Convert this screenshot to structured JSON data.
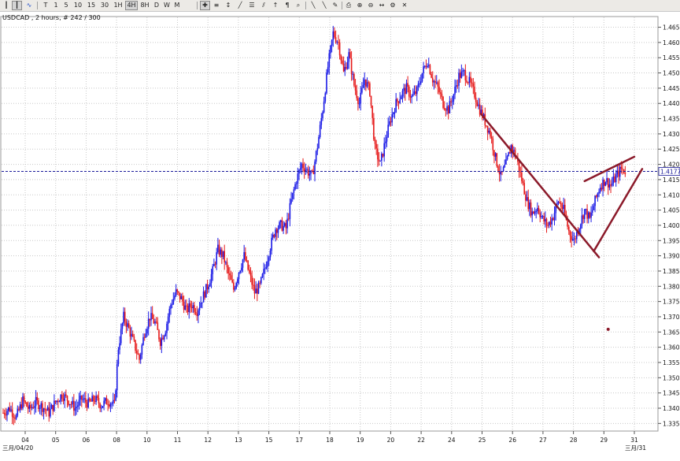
{
  "toolbar": {
    "timeframes": [
      "T",
      "1",
      "5",
      "10",
      "15",
      "30",
      "1H",
      "4H",
      "8H",
      "D",
      "W",
      "M"
    ],
    "active_timeframe": "2H"
  },
  "chart_data": {
    "type": "candlestick",
    "title": "USDCAD , 2 hours, # 242 / 300",
    "ylim": [
      1.3325,
      1.4685
    ],
    "y_ticks": [
      "1.4650",
      "1.4600",
      "1.4550",
      "1.4500",
      "1.4450",
      "1.4400",
      "1.4350",
      "1.4300",
      "1.4250",
      "1.4200",
      "1.4150",
      "1.4100",
      "1.4050",
      "1.4000",
      "1.3950",
      "1.3900",
      "1.3850",
      "1.3800",
      "1.3750",
      "1.3700",
      "1.3650",
      "1.3600",
      "1.3550",
      "1.3500",
      "1.3450",
      "1.3400",
      "1.3350"
    ],
    "x_ticks": [
      "04",
      "05",
      "06",
      "09",
      "10",
      "11",
      "12",
      "13",
      "16",
      "17",
      "18",
      "19",
      "20",
      "23",
      "24",
      "25",
      "26",
      "27",
      "30",
      "31",
      "02",
      "03",
      "06",
      "07",
      "08",
      "09",
      "10",
      "13",
      "14",
      "15",
      "16",
      "17",
      "20",
      "21",
      "22",
      "23",
      "24",
      "27",
      "28",
      "29",
      "30",
      "31"
    ],
    "x_tick_labels": [
      "04",
      "05",
      "06",
      "08",
      "10",
      "11",
      "12",
      "13",
      "15",
      "17",
      "18",
      "19",
      "20",
      "22",
      "24",
      "25",
      "26",
      "27",
      "28",
      "29",
      "31"
    ],
    "x_start_label": "三月/04/20",
    "x_end_label": "三月/31",
    "current_price": "1.4177",
    "current_price_value": 1.4177,
    "grid": true,
    "bull_color": "#1a1ae6",
    "bear_color": "#e61a1a",
    "annotation_color": "#8b1a2a",
    "path_points": [
      [
        0,
        1.3385
      ],
      [
        5,
        1.34
      ],
      [
        10,
        1.337
      ],
      [
        15,
        1.3425
      ],
      [
        20,
        1.3395
      ],
      [
        25,
        1.342
      ],
      [
        30,
        1.3405
      ],
      [
        35,
        1.3385
      ],
      [
        40,
        1.342
      ],
      [
        45,
        1.3445
      ],
      [
        50,
        1.3425
      ],
      [
        55,
        1.34
      ],
      [
        60,
        1.343
      ],
      [
        65,
        1.3415
      ],
      [
        70,
        1.343
      ],
      [
        75,
        1.341
      ],
      [
        80,
        1.3425
      ],
      [
        85,
        1.341
      ],
      [
        88,
        1.36
      ],
      [
        92,
        1.37
      ],
      [
        96,
        1.366
      ],
      [
        100,
        1.361
      ],
      [
        104,
        1.356
      ],
      [
        108,
        1.365
      ],
      [
        112,
        1.37
      ],
      [
        116,
        1.368
      ],
      [
        120,
        1.362
      ],
      [
        124,
        1.366
      ],
      [
        128,
        1.374
      ],
      [
        132,
        1.378
      ],
      [
        136,
        1.376
      ],
      [
        140,
        1.372
      ],
      [
        144,
        1.374
      ],
      [
        148,
        1.372
      ],
      [
        152,
        1.376
      ],
      [
        156,
        1.38
      ],
      [
        160,
        1.385
      ],
      [
        164,
        1.392
      ],
      [
        168,
        1.39
      ],
      [
        172,
        1.384
      ],
      [
        176,
        1.379
      ],
      [
        180,
        1.385
      ],
      [
        184,
        1.39
      ],
      [
        188,
        1.384
      ],
      [
        192,
        1.378
      ],
      [
        196,
        1.38
      ],
      [
        200,
        1.386
      ],
      [
        204,
        1.393
      ],
      [
        208,
        1.399
      ],
      [
        212,
        1.4
      ],
      [
        216,
        1.399
      ],
      [
        220,
        1.408
      ],
      [
        224,
        1.415
      ],
      [
        228,
        1.42
      ],
      [
        232,
        1.418
      ],
      [
        236,
        1.416
      ],
      [
        240,
        1.426
      ],
      [
        244,
        1.438
      ],
      [
        248,
        1.452
      ],
      [
        252,
        1.463
      ],
      [
        256,
        1.46
      ],
      [
        260,
        1.45
      ],
      [
        264,
        1.456
      ],
      [
        268,
        1.446
      ],
      [
        272,
        1.44
      ],
      [
        276,
        1.448
      ],
      [
        280,
        1.444
      ],
      [
        284,
        1.425
      ],
      [
        288,
        1.42
      ],
      [
        292,
        1.428
      ],
      [
        296,
        1.435
      ],
      [
        300,
        1.44
      ],
      [
        304,
        1.443
      ],
      [
        308,
        1.445
      ],
      [
        312,
        1.442
      ],
      [
        316,
        1.444
      ],
      [
        320,
        1.45
      ],
      [
        324,
        1.454
      ],
      [
        328,
        1.448
      ],
      [
        332,
        1.445
      ],
      [
        336,
        1.44
      ],
      [
        340,
        1.438
      ],
      [
        344,
        1.443
      ],
      [
        348,
        1.449
      ],
      [
        352,
        1.45
      ],
      [
        356,
        1.447
      ],
      [
        360,
        1.443
      ],
      [
        364,
        1.438
      ],
      [
        368,
        1.434
      ],
      [
        372,
        1.43
      ],
      [
        376,
        1.422
      ],
      [
        380,
        1.416
      ],
      [
        384,
        1.42
      ],
      [
        388,
        1.426
      ],
      [
        392,
        1.422
      ],
      [
        396,
        1.415
      ],
      [
        400,
        1.408
      ],
      [
        404,
        1.404
      ],
      [
        408,
        1.406
      ],
      [
        412,
        1.402
      ],
      [
        416,
        1.4
      ],
      [
        420,
        1.403
      ],
      [
        424,
        1.408
      ],
      [
        428,
        1.405
      ],
      [
        432,
        1.398
      ],
      [
        436,
        1.395
      ],
      [
        440,
        1.4
      ],
      [
        444,
        1.405
      ],
      [
        448,
        1.402
      ],
      [
        452,
        1.408
      ],
      [
        456,
        1.413
      ],
      [
        460,
        1.415
      ],
      [
        464,
        1.413
      ],
      [
        468,
        1.416
      ],
      [
        472,
        1.4185
      ],
      [
        476,
        1.4177
      ]
    ]
  }
}
